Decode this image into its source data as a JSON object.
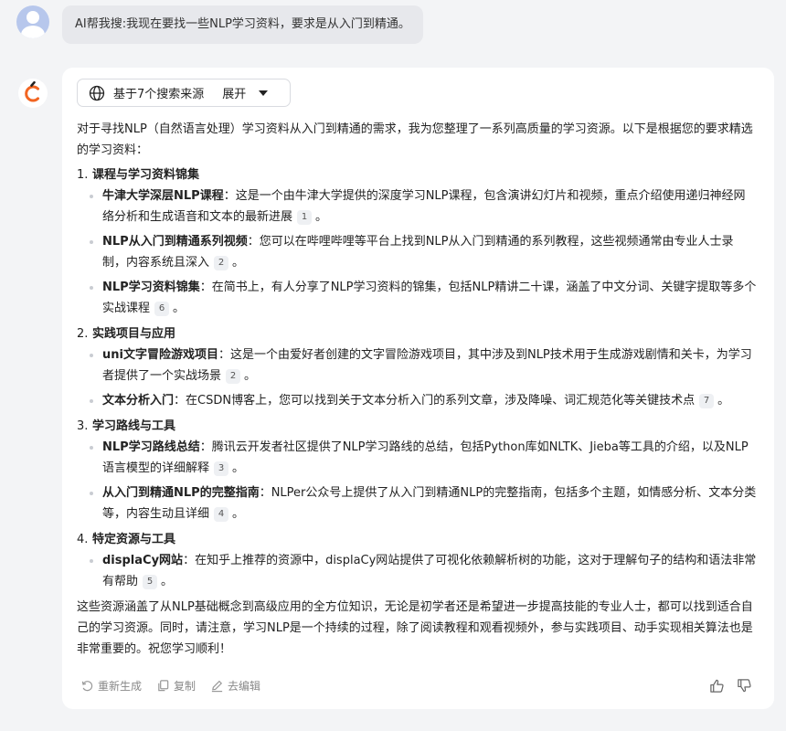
{
  "user": {
    "message": "AI帮我搜:我现在要找一些NLP学习资料，要求是从入门到精通。"
  },
  "sources": {
    "label": "基于7个搜索来源",
    "toggle": "展开"
  },
  "answer": {
    "intro": "对于寻找NLP（自然语言处理）学习资料从入门到精通的需求，我为您整理了一系列高质量的学习资源。以下是根据您的要求精选的学习资料：",
    "sections": [
      {
        "number": "1.",
        "title": "课程与学习资料锦集",
        "items": [
          {
            "title": "牛津大学深层NLP课程",
            "text": "：这是一个由牛津大学提供的深度学习NLP课程，包含演讲幻灯片和视频，重点介绍使用递归神经网络分析和生成语音和文本的最新进展",
            "cite": "1",
            "end": "。"
          },
          {
            "title": "NLP从入门到精通系列视频",
            "text": "：您可以在哔哩哔哩等平台上找到NLP从入门到精通的系列教程，这些视频通常由专业人士录制，内容系统且深入",
            "cite": "2",
            "end": "。"
          },
          {
            "title": "NLP学习资料锦集",
            "text": "：在简书上，有人分享了NLP学习资料的锦集，包括NLP精讲二十课，涵盖了中文分词、关键字提取等多个实战课程",
            "cite": "6",
            "end": "。"
          }
        ]
      },
      {
        "number": "2.",
        "title": "实践项目与应用",
        "items": [
          {
            "title": "uni文字冒险游戏项目",
            "text": "：这是一个由爱好者创建的文字冒险游戏项目，其中涉及到NLP技术用于生成游戏剧情和关卡，为学习者提供了一个实战场景",
            "cite": "2",
            "end": "。"
          },
          {
            "title": "文本分析入门",
            "text": "：在CSDN博客上，您可以找到关于文本分析入门的系列文章，涉及降噪、词汇规范化等关键技术点",
            "cite": "7",
            "end": "。"
          }
        ]
      },
      {
        "number": "3.",
        "title": "学习路线与工具",
        "items": [
          {
            "title": "NLP学习路线总结",
            "text": "：腾讯云开发者社区提供了NLP学习路线的总结，包括Python库如NLTK、Jieba等工具的介绍，以及NLP语言模型的详细解释",
            "cite": "3",
            "end": "。"
          },
          {
            "title": "从入门到精通NLP的完整指南",
            "text": "：NLPer公众号上提供了从入门到精通NLP的完整指南，包括多个主题，如情感分析、文本分类等，内容生动且详细",
            "cite": "4",
            "end": "。"
          }
        ]
      },
      {
        "number": "4.",
        "title": "特定资源与工具",
        "items": [
          {
            "title": "displaCy网站",
            "text": "：在知乎上推荐的资源中，displaCy网站提供了可视化依赖解析树的功能，这对于理解句子的结构和语法非常有帮助",
            "cite": "5",
            "end": "。"
          }
        ]
      }
    ],
    "summary": "这些资源涵盖了从NLP基础概念到高级应用的全方位知识，无论是初学者还是希望进一步提高技能的专业人士，都可以找到适合自己的学习资源。同时，请注意，学习NLP是一个持续的过程，除了阅读教程和观看视频外，参与实践项目、动手实现相关算法也是非常重要的。祝您学习顺利！"
  },
  "actions": {
    "regenerate": "重新生成",
    "copy": "复制",
    "edit": "去编辑"
  },
  "icons": {
    "sources": "globe-icon",
    "toggle": "caret-down-icon",
    "regenerate": "refresh-icon",
    "copy": "copy-icon",
    "edit": "edit-icon",
    "like": "thumbs-up-icon",
    "dislike": "thumbs-down-icon"
  },
  "colors": {
    "page_bg": "#f3f4f6",
    "card_bg": "#ffffff",
    "user_bubble": "#e7e8ec",
    "logo_orange": "#f26522"
  }
}
